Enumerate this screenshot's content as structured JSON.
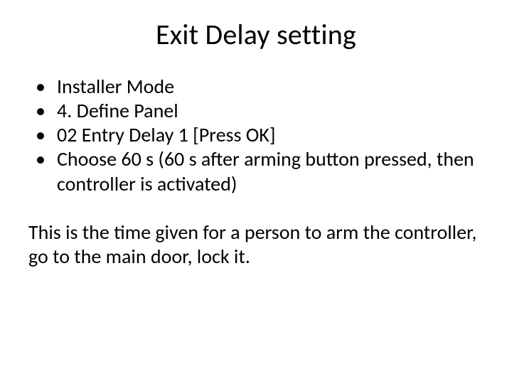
{
  "title": "Exit Delay setting",
  "bullets": [
    "Installer Mode",
    "4. Define Panel",
    "02 Entry Delay 1 [Press OK]",
    "Choose 60 s (60 s after arming button pressed, then controller is activated)"
  ],
  "paragraph": "This is the time given for a person to arm the controller, go to the main door, lock it."
}
